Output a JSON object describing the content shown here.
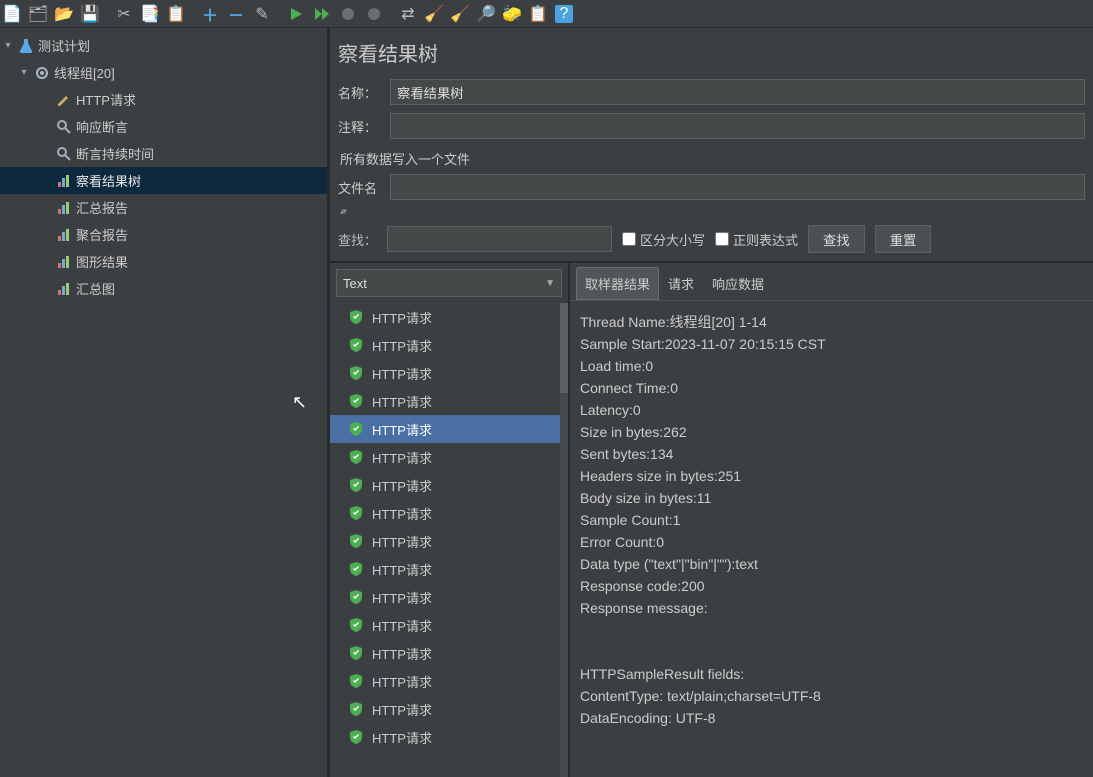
{
  "toolbar_icons": [
    {
      "name": "new-file-icon",
      "glyph": "📄"
    },
    {
      "name": "template-icon",
      "glyph": "🗂"
    },
    {
      "name": "open-icon",
      "glyph": "📂"
    },
    {
      "name": "save-icon",
      "glyph": "💾"
    },
    {
      "name": "sep"
    },
    {
      "name": "cut-icon",
      "glyph": "✂"
    },
    {
      "name": "copy-icon",
      "glyph": "📑"
    },
    {
      "name": "paste-icon",
      "glyph": "📋"
    },
    {
      "name": "sep"
    },
    {
      "name": "plus-icon",
      "glyph": "＋"
    },
    {
      "name": "minus-icon",
      "glyph": "－"
    },
    {
      "name": "wand-icon",
      "glyph": "✎"
    },
    {
      "name": "sep"
    },
    {
      "name": "run-icon",
      "glyph": "▶"
    },
    {
      "name": "run-next-icon",
      "glyph": "⏭"
    },
    {
      "name": "stop-icon",
      "glyph": "⏹"
    },
    {
      "name": "shutdown-icon",
      "glyph": "⏹"
    },
    {
      "name": "sep"
    },
    {
      "name": "toggle-icon",
      "glyph": "⇄"
    },
    {
      "name": "clear-icon",
      "glyph": "🧹"
    },
    {
      "name": "clear-all-icon",
      "glyph": "🧹"
    },
    {
      "name": "find-icon",
      "glyph": "🔎"
    },
    {
      "name": "reset-search-icon",
      "glyph": "🧽"
    },
    {
      "name": "func-helper-icon",
      "glyph": "📋"
    },
    {
      "name": "help-icon",
      "glyph": "?"
    }
  ],
  "tree": {
    "root": {
      "label": "测试计划"
    },
    "group": {
      "label": "线程组[20]"
    },
    "children": [
      {
        "label": "HTTP请求",
        "icon": "pencil"
      },
      {
        "label": "响应断言",
        "icon": "mag"
      },
      {
        "label": "断言持续时间",
        "icon": "mag"
      },
      {
        "label": "察看结果树",
        "icon": "chart",
        "selected": true
      },
      {
        "label": "汇总报告",
        "icon": "chart"
      },
      {
        "label": "聚合报告",
        "icon": "chart"
      },
      {
        "label": "图形结果",
        "icon": "chart"
      },
      {
        "label": "汇总图",
        "icon": "chart"
      }
    ]
  },
  "pane": {
    "title": "察看结果树",
    "name_label": "名称：",
    "name_value": "察看结果树",
    "comment_label": "注释：",
    "comment_value": "",
    "file_header": "所有数据写入一个文件",
    "file_label": "文件名"
  },
  "search": {
    "label": "查找：",
    "value": "",
    "case_label": "区分大小写",
    "regex_label": "正则表达式",
    "btn_find": "查找",
    "btn_reset": "重置",
    "renderer": "Text"
  },
  "results": [
    {
      "label": "HTTP请求"
    },
    {
      "label": "HTTP请求"
    },
    {
      "label": "HTTP请求"
    },
    {
      "label": "HTTP请求"
    },
    {
      "label": "HTTP请求",
      "selected": true
    },
    {
      "label": "HTTP请求"
    },
    {
      "label": "HTTP请求"
    },
    {
      "label": "HTTP请求"
    },
    {
      "label": "HTTP请求"
    },
    {
      "label": "HTTP请求"
    },
    {
      "label": "HTTP请求"
    },
    {
      "label": "HTTP请求"
    },
    {
      "label": "HTTP请求"
    },
    {
      "label": "HTTP请求"
    },
    {
      "label": "HTTP请求"
    },
    {
      "label": "HTTP请求"
    }
  ],
  "tabs": [
    {
      "label": "取样器结果",
      "active": true
    },
    {
      "label": "请求"
    },
    {
      "label": "响应数据"
    }
  ],
  "detail_lines": [
    "Thread Name:线程组[20] 1-14",
    "Sample Start:2023-11-07 20:15:15 CST",
    "Load time:0",
    "Connect Time:0",
    "Latency:0",
    "Size in bytes:262",
    "Sent bytes:134",
    "Headers size in bytes:251",
    "Body size in bytes:11",
    "Sample Count:1",
    "Error Count:0",
    "Data type (\"text\"|\"bin\"|\"\"):text",
    "Response code:200",
    "Response message:",
    "",
    "",
    "HTTPSampleResult fields:",
    "ContentType: text/plain;charset=UTF-8",
    "DataEncoding: UTF-8"
  ]
}
